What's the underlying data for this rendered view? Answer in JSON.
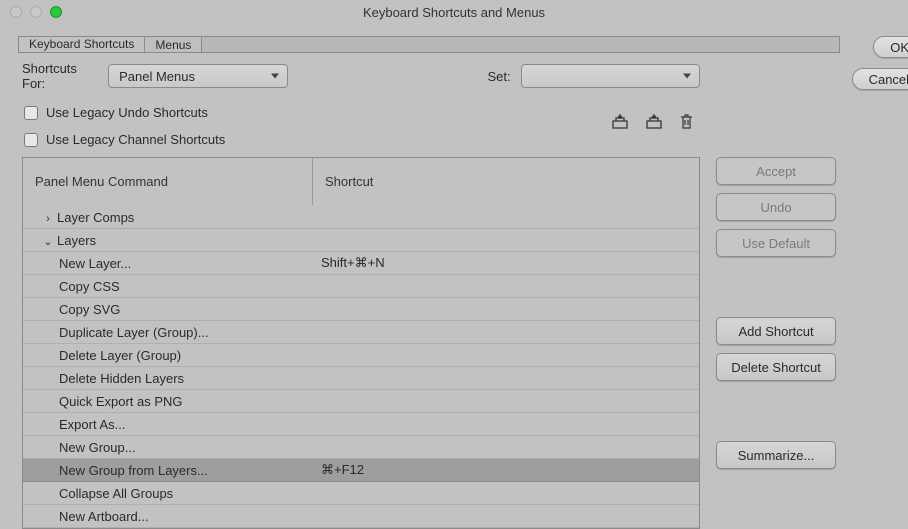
{
  "window": {
    "title": "Keyboard Shortcuts and Menus"
  },
  "tabs": {
    "keyboard": "Keyboard Shortcuts",
    "menus": "Menus"
  },
  "controls": {
    "shortcuts_for_label": "Shortcuts For:",
    "shortcuts_for_value": "Panel Menus",
    "set_label": "Set:",
    "set_value": "",
    "legacy_undo": "Use Legacy Undo Shortcuts",
    "legacy_channel": "Use Legacy Channel Shortcuts"
  },
  "headers": {
    "command": "Panel Menu Command",
    "shortcut": "Shortcut"
  },
  "rows": [
    {
      "label": "Layer Comps",
      "shortcut": "",
      "indent": 1,
      "caret": "right"
    },
    {
      "label": "Layers",
      "shortcut": "",
      "indent": 1,
      "caret": "down"
    },
    {
      "label": "New Layer...",
      "shortcut": "Shift+⌘+N",
      "indent": 2
    },
    {
      "label": "Copy CSS",
      "shortcut": "",
      "indent": 2
    },
    {
      "label": "Copy SVG",
      "shortcut": "",
      "indent": 2
    },
    {
      "label": "Duplicate Layer (Group)...",
      "shortcut": "",
      "indent": 2
    },
    {
      "label": "Delete Layer (Group)",
      "shortcut": "",
      "indent": 2
    },
    {
      "label": "Delete Hidden Layers",
      "shortcut": "",
      "indent": 2
    },
    {
      "label": "Quick Export as PNG",
      "shortcut": "",
      "indent": 2
    },
    {
      "label": "Export As...",
      "shortcut": "",
      "indent": 2
    },
    {
      "label": "New Group...",
      "shortcut": "",
      "indent": 2
    },
    {
      "label": "New Group from Layers...",
      "shortcut": "⌘+F12",
      "indent": 2,
      "selected": true
    },
    {
      "label": "Collapse All Groups",
      "shortcut": "",
      "indent": 2
    },
    {
      "label": "New Artboard...",
      "shortcut": "",
      "indent": 2
    }
  ],
  "mid_buttons": {
    "accept": "Accept",
    "undo": "Undo",
    "use_default": "Use Default",
    "add_shortcut": "Add Shortcut",
    "delete_shortcut": "Delete Shortcut",
    "summarize": "Summarize..."
  },
  "right_buttons": {
    "ok": "OK",
    "cancel": "Cancel"
  }
}
